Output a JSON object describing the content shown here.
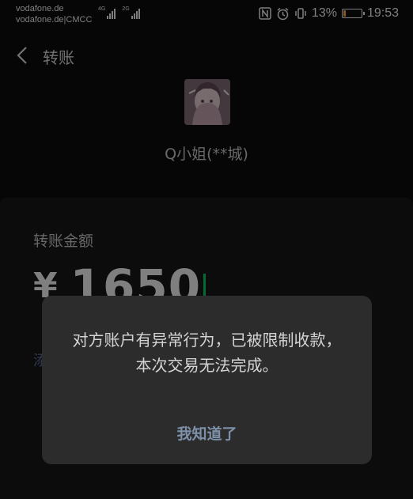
{
  "status_bar": {
    "carrier_1": "vodafone.de",
    "carrier_2": "vodafone.de|CMCC",
    "network_1": "4G",
    "network_2": "2G",
    "battery_percent": "13%",
    "battery_level": 0.13,
    "battery_color": "#f0a23a",
    "time": "19:53",
    "icons": [
      "nfc-icon",
      "alarm-icon",
      "vibrate-icon"
    ]
  },
  "header": {
    "title": "转账",
    "back_icon": "chevron-left-icon"
  },
  "recipient": {
    "name": "Q小姐(**城)"
  },
  "transfer": {
    "amount_label": "转账金额",
    "currency": "¥",
    "amount": "1650",
    "note_link": "添"
  },
  "dialog": {
    "message": "对方账户有异常行为，已被限制收款，本次交易无法完成。",
    "confirm_label": "我知道了"
  },
  "colors": {
    "background": "#0b0b0b",
    "dialog": "#2c2c2c",
    "link": "#576b95",
    "caret": "#07c160"
  }
}
